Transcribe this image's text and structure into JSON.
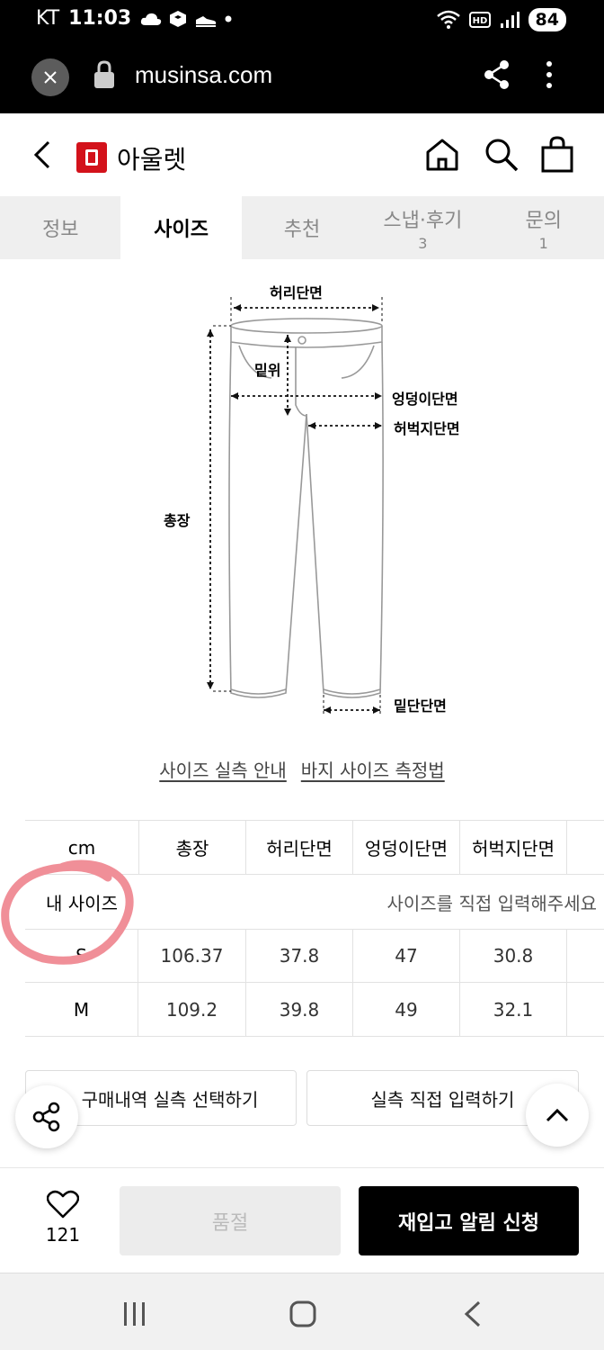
{
  "status_bar": {
    "carrier": "KT",
    "time": "11:03",
    "battery": "84"
  },
  "browser": {
    "url": "musinsa.com"
  },
  "header": {
    "title": "아울렛"
  },
  "tabs": [
    {
      "label": "정보",
      "count": ""
    },
    {
      "label": "사이즈",
      "count": ""
    },
    {
      "label": "추천",
      "count": ""
    },
    {
      "label": "스냅·후기",
      "count": "3"
    },
    {
      "label": "문의",
      "count": "1"
    }
  ],
  "diagram": {
    "waist": "허리단면",
    "rise": "밑위",
    "hip": "엉덩이단면",
    "thigh": "허벅지단면",
    "length": "총장",
    "hem": "밑단단면"
  },
  "links": {
    "guide": "사이즈 실측 안내",
    "measure": "바지 사이즈 측정법"
  },
  "size_table": {
    "unit": "cm",
    "columns": [
      "총장",
      "허리단면",
      "엉덩이단면",
      "허벅지단면"
    ],
    "my_size_label": "내 사이즈",
    "my_size_hint": "사이즈를 직접 입력해주세요",
    "rows": [
      {
        "size": "S",
        "values": [
          "106.37",
          "37.8",
          "47",
          "30.8"
        ]
      },
      {
        "size": "M",
        "values": [
          "109.2",
          "39.8",
          "49",
          "32.1"
        ]
      }
    ]
  },
  "buttons": {
    "purchase_history": "구매내역 실측 선택하기",
    "direct_input": "실측 직접 입력하기"
  },
  "action_bar": {
    "like_count": "121",
    "soldout": "품절",
    "restock": "재입고 알림 신청"
  },
  "colors": {
    "brand": "#d3121b",
    "annotation": "#f08f98"
  }
}
